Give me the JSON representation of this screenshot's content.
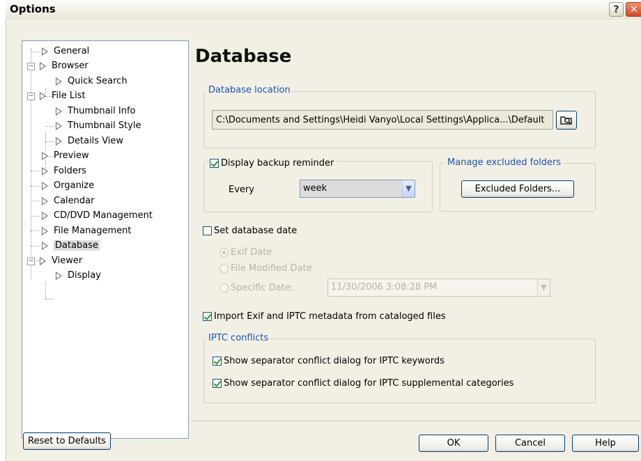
{
  "window": {
    "title": "Options",
    "help_glyph": "?",
    "close_glyph": "✕"
  },
  "tree": [
    {
      "label": "General"
    },
    {
      "label": "Browser",
      "expander": "−"
    },
    {
      "label": "Quick Search"
    },
    {
      "label": "File List",
      "expander": "−"
    },
    {
      "label": "Thumbnail Info"
    },
    {
      "label": "Thumbnail Style"
    },
    {
      "label": "Details View"
    },
    {
      "label": "Preview"
    },
    {
      "label": "Folders"
    },
    {
      "label": "Organize"
    },
    {
      "label": "Calendar"
    },
    {
      "label": "CD/DVD Management"
    },
    {
      "label": "File Management"
    },
    {
      "label": "Database",
      "selected": true
    },
    {
      "label": "Viewer",
      "expander": "−"
    },
    {
      "label": "Display"
    }
  ],
  "page": {
    "heading": "Database"
  },
  "location": {
    "legend": "Database location",
    "path": "C:\\Documents and Settings\\Heidi Vanyo\\Local Settings\\Applica...\\Default",
    "browse_icon": "folder-browse-icon"
  },
  "backup": {
    "label": "Display backup reminder",
    "checked": true,
    "every_label": "Every",
    "interval": "week"
  },
  "excluded": {
    "legend": "Manage excluded folders",
    "button": "Excluded Folders..."
  },
  "dbdate": {
    "label": "Set database date",
    "checked": false,
    "options": [
      "Exif Date",
      "File Modified Date",
      "Specific Date:"
    ],
    "selected_option": "Exif Date",
    "specific_value": "11/30/2006  3:08:28 PM"
  },
  "import": {
    "label": "Import Exif and IPTC metadata from cataloged files",
    "checked": true
  },
  "iptc": {
    "legend": "IPTC conflicts",
    "keywords": "Show separator conflict dialog for IPTC keywords",
    "supplemental": "Show separator conflict dialog for IPTC supplemental categories"
  },
  "buttons": {
    "reset": "Reset to Defaults",
    "ok": "OK",
    "cancel": "Cancel",
    "help": "Help"
  },
  "colors": {
    "legend": "#1f50b8",
    "check": "#21a121",
    "dialog_bg": "#f2f0e4"
  }
}
